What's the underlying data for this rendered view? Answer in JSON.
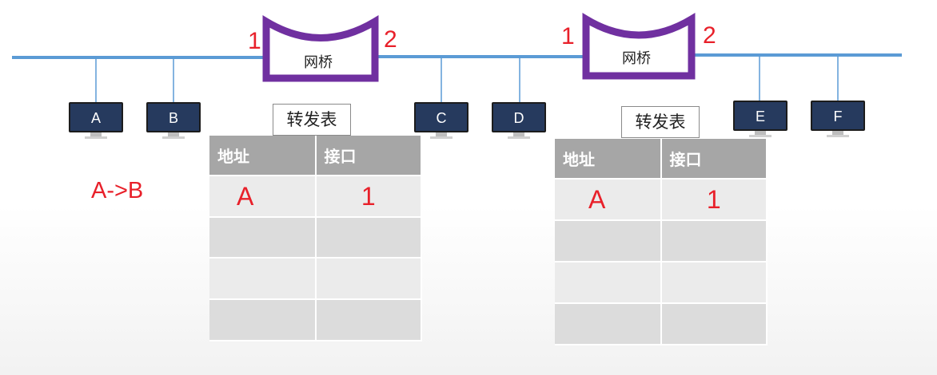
{
  "hosts": [
    "A",
    "B",
    "C",
    "D",
    "E",
    "F"
  ],
  "bridge1": {
    "label": "网桥",
    "port_left": "1",
    "port_right": "2"
  },
  "bridge2": {
    "label": "网桥",
    "port_left": "1",
    "port_right": "2"
  },
  "frame_label": "A->B",
  "table1": {
    "title": "转发表",
    "headers": [
      "地址",
      "接口"
    ],
    "rows": [
      [
        "A",
        "1"
      ],
      [
        "",
        ""
      ],
      [
        "",
        ""
      ],
      [
        "",
        ""
      ]
    ]
  },
  "table2": {
    "title": "转发表",
    "headers": [
      "地址",
      "接口"
    ],
    "rows": [
      [
        "A",
        "1"
      ],
      [
        "",
        ""
      ],
      [
        "",
        ""
      ],
      [
        "",
        ""
      ]
    ]
  },
  "colors": {
    "link": "#5b9bd5",
    "bridge": "#7030a0",
    "highlight": "#e8202a",
    "host_screen": "#263a5e",
    "table_header": "#a6a6a6"
  }
}
